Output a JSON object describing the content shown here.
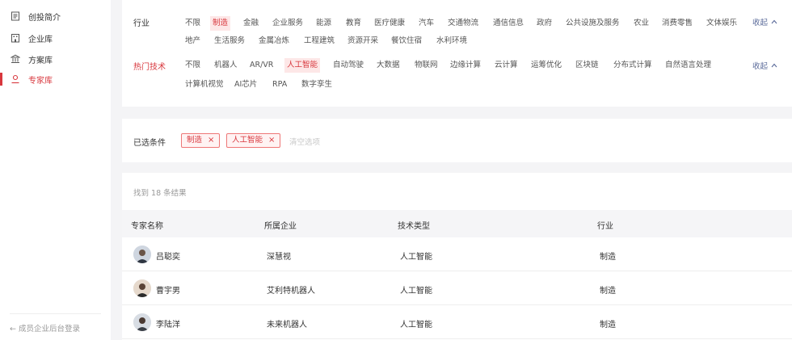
{
  "sidebar": {
    "items": [
      {
        "label": "创投简介",
        "icon": "document-icon",
        "active": false
      },
      {
        "label": "企业库",
        "icon": "building-icon",
        "active": false
      },
      {
        "label": "方案库",
        "icon": "bank-icon",
        "active": false
      },
      {
        "label": "专家库",
        "icon": "user-icon",
        "active": true
      }
    ],
    "back_link": "← 成员企业后台登录"
  },
  "filters": {
    "industry": {
      "label": "行业",
      "tags": [
        "不限",
        "制造",
        "金融",
        "企业服务",
        "能源",
        "教育",
        "医疗健康",
        "汽车",
        "交通物流",
        "通信信息",
        "政府",
        "公共设施及服务",
        "农业",
        "消费零售",
        "文体娱乐",
        "地产",
        "生活服务",
        "金属冶炼",
        "工程建筑",
        "资源开采",
        "餐饮住宿",
        "水利环境"
      ],
      "selected": "制造",
      "collapse": "收起"
    },
    "tech": {
      "label": "热门技术",
      "tags": [
        "不限",
        "机器人",
        "AR/VR",
        "人工智能",
        "自动驾驶",
        "大数据",
        "物联网",
        "边缘计算",
        "云计算",
        "运筹优化",
        "区块链",
        "分布式计算",
        "自然语言处理",
        "计算机视觉",
        "AI芯片",
        "RPA",
        "数字孪生"
      ],
      "selected": "人工智能",
      "collapse": "收起"
    }
  },
  "selected_conditions": {
    "label": "已选条件",
    "chips": [
      "制造",
      "人工智能"
    ],
    "clear_label": "清空选项"
  },
  "results": {
    "count_text": "找到 18 条结果",
    "columns": [
      "专家名称",
      "所属企业",
      "技术类型",
      "行业"
    ],
    "rows": [
      {
        "name": "吕聪奕",
        "company": "深慧视",
        "tech": "人工智能",
        "industry": "制造"
      },
      {
        "name": "曹宇男",
        "company": "艾利特机器人",
        "tech": "人工智能",
        "industry": "制造"
      },
      {
        "name": "李陆洋",
        "company": "未来机器人",
        "tech": "人工智能",
        "industry": "制造"
      }
    ]
  },
  "colors": {
    "accent": "#d8373d",
    "link": "#5b6b9a"
  }
}
